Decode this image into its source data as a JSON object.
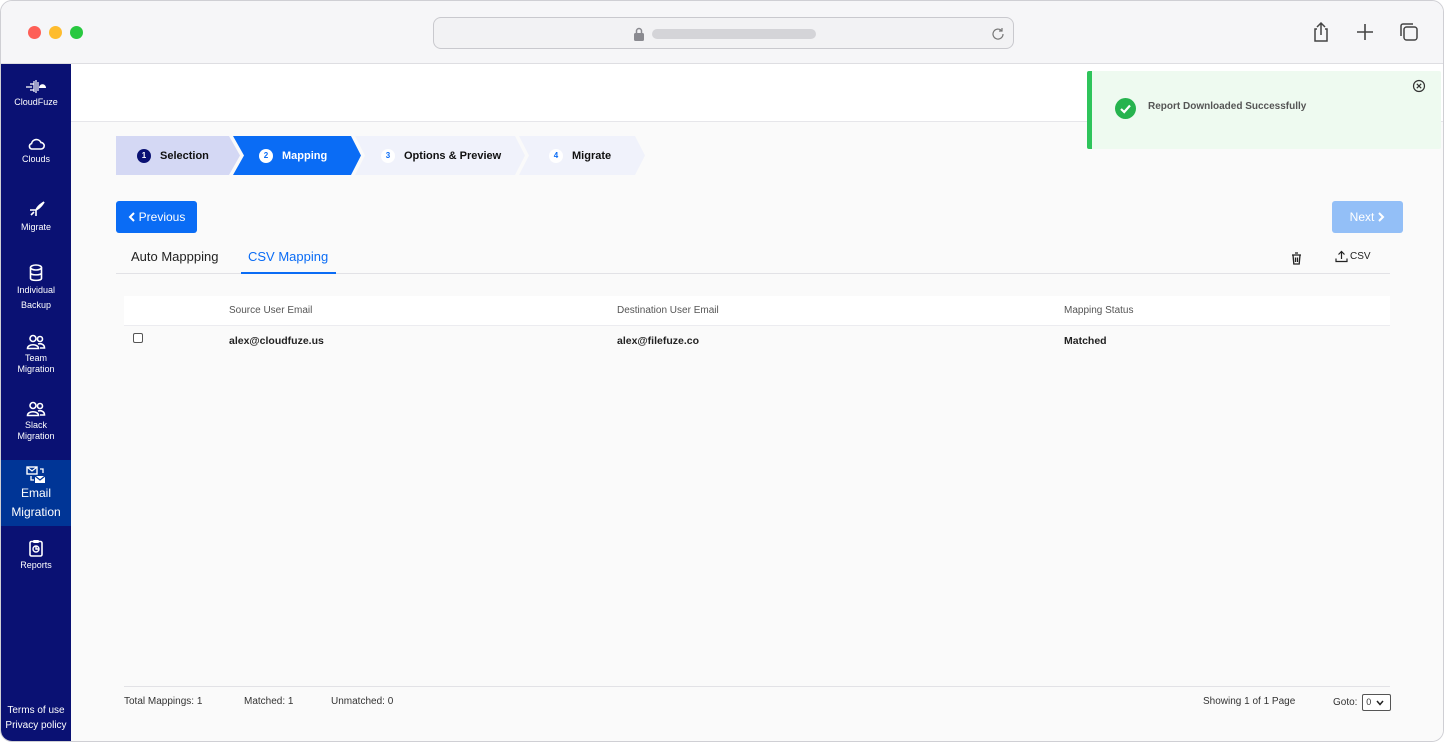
{
  "sidebar": {
    "brand": "CloudFuze",
    "items": [
      {
        "label": "Clouds"
      },
      {
        "label": "Migrate"
      },
      {
        "label": "Individual Backup",
        "line1": "Individual",
        "line2": "Backup"
      },
      {
        "label": "Team Migration",
        "line1": "Team",
        "line2": "Migration"
      },
      {
        "label": "Slack Migration",
        "line1": "Slack",
        "line2": "Migration"
      },
      {
        "label": "Email Migration",
        "line1": "Email",
        "line2": "Migration"
      },
      {
        "label": "Reports"
      }
    ],
    "footer": {
      "terms": "Terms of use",
      "privacy": "Privacy policy"
    }
  },
  "steps": [
    {
      "num": "1",
      "label": "Selection"
    },
    {
      "num": "2",
      "label": "Mapping"
    },
    {
      "num": "3",
      "label": "Options & Preview"
    },
    {
      "num": "4",
      "label": "Migrate"
    }
  ],
  "actions": {
    "previous": "Previous",
    "next": "Next"
  },
  "tabs": {
    "auto": "Auto Mappping",
    "csv": "CSV Mapping",
    "csv_upload": "CSV"
  },
  "table": {
    "headers": {
      "source": "Source User Email",
      "destination": "Destination User Email",
      "status": "Mapping Status"
    },
    "rows": [
      {
        "source": "alex@cloudfuze.us",
        "destination": "alex@filefuze.co",
        "status": "Matched"
      }
    ]
  },
  "footer": {
    "total": "Total Mappings: 1",
    "matched": "Matched: 1",
    "unmatched": "Unmatched: 0",
    "showing": "Showing 1 of 1 Page",
    "goto_label": "Goto:",
    "goto_value": "0"
  },
  "toast": {
    "message": "Report Downloaded Successfully"
  },
  "colors": {
    "sidebar": "#0a1173",
    "accent": "#0a6cf5",
    "success": "#26b34e"
  }
}
